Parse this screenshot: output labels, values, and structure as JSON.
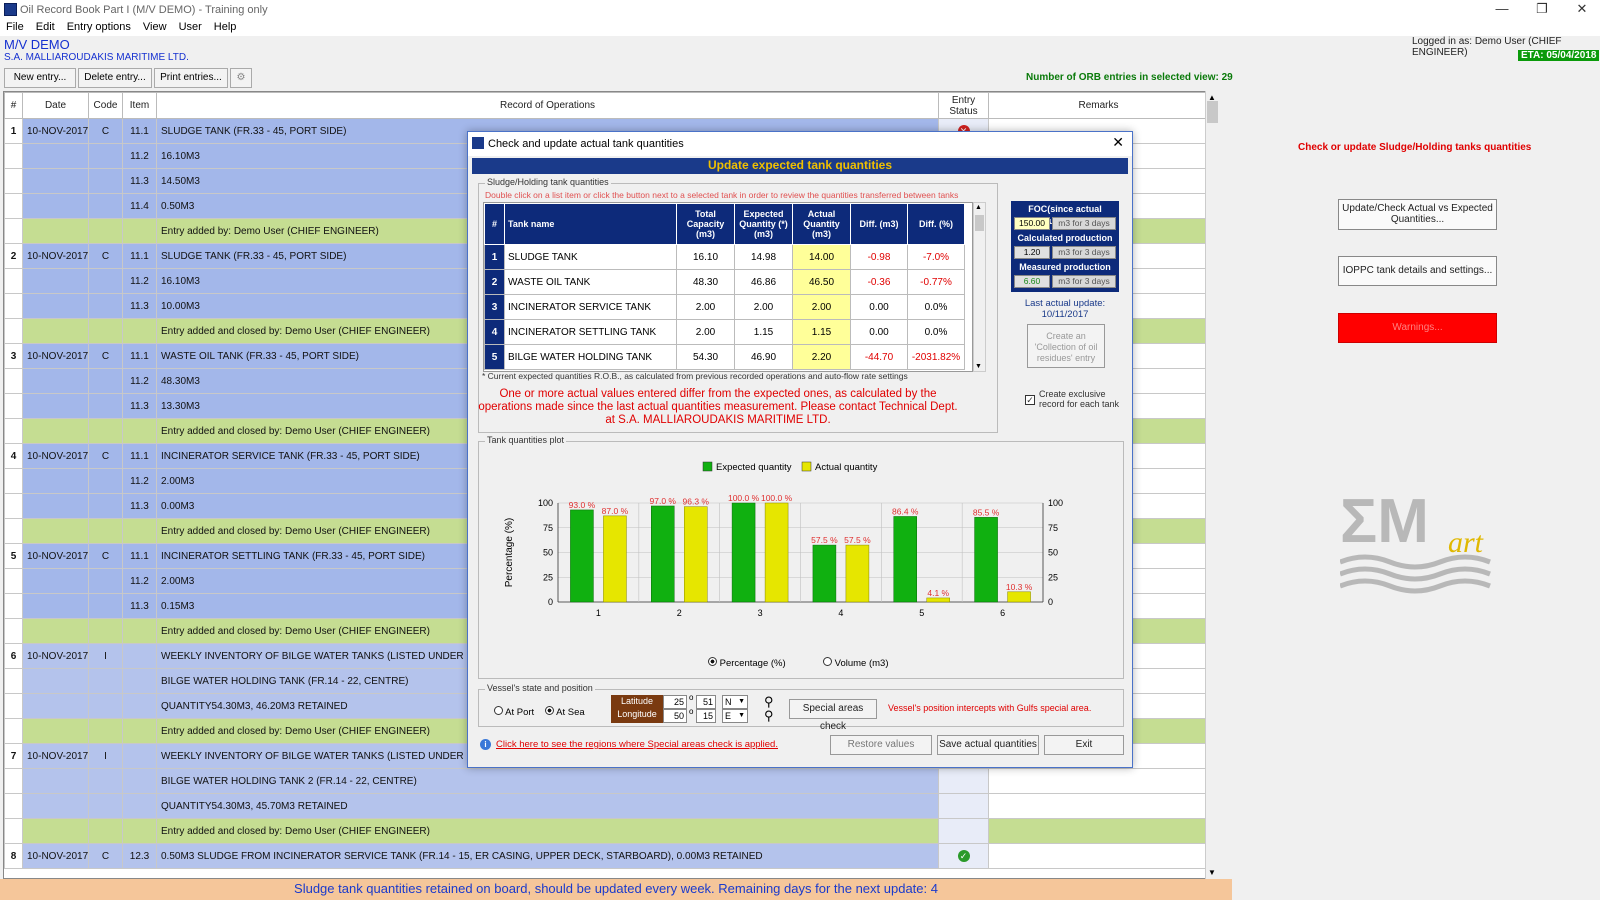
{
  "window": {
    "title": "Oil Record Book Part I (M/V DEMO) - Training only",
    "minimize": "—",
    "restore": "❐",
    "close": "✕"
  },
  "menu": [
    "File",
    "Edit",
    "Entry options",
    "View",
    "User",
    "Help"
  ],
  "header": {
    "vessel": "M/V DEMO",
    "company": "S.A. MALLIAROUDAKIS MARITIME LTD.",
    "logged_in": "Logged in as:  Demo User (CHIEF ENGINEER)",
    "eta": "ETA: 05/04/2018"
  },
  "toolbar": {
    "new": "New entry...",
    "delete": "Delete entry...",
    "print": "Print entries...",
    "count": "Number of ORB entries in selected view: 29"
  },
  "grid": {
    "columns": [
      "#",
      "Date",
      "Code",
      "Item",
      "Record of Operations",
      "Entry Status",
      "Remarks"
    ],
    "rows": [
      {
        "type": "blue",
        "num": "1",
        "date": "10-NOV-2017",
        "code": "C",
        "item": "11.1",
        "rec": "SLUDGE TANK (FR.33 - 45, PORT SIDE)",
        "status": "x"
      },
      {
        "type": "blue",
        "num": "",
        "date": "",
        "code": "",
        "item": "11.2",
        "rec": "16.10M3",
        "status": ""
      },
      {
        "type": "blue",
        "num": "",
        "date": "",
        "code": "",
        "item": "11.3",
        "rec": "14.50M3",
        "status": ""
      },
      {
        "type": "blue",
        "num": "",
        "date": "",
        "code": "",
        "item": "11.4",
        "rec": "0.50M3",
        "status": ""
      },
      {
        "type": "green",
        "num": "",
        "date": "",
        "code": "",
        "item": "",
        "rec": "Entry added by: Demo User (CHIEF ENGINEER)",
        "status": ""
      },
      {
        "type": "blue",
        "num": "2",
        "date": "10-NOV-2017",
        "code": "C",
        "item": "11.1",
        "rec": "SLUDGE TANK (FR.33 - 45, PORT SIDE)",
        "status": ""
      },
      {
        "type": "blue",
        "num": "",
        "date": "",
        "code": "",
        "item": "11.2",
        "rec": "16.10M3",
        "status": ""
      },
      {
        "type": "blue",
        "num": "",
        "date": "",
        "code": "",
        "item": "11.3",
        "rec": "10.00M3",
        "status": ""
      },
      {
        "type": "green",
        "num": "",
        "date": "",
        "code": "",
        "item": "",
        "rec": "Entry added and closed by: Demo User (CHIEF ENGINEER)",
        "status": ""
      },
      {
        "type": "blue",
        "num": "3",
        "date": "10-NOV-2017",
        "code": "C",
        "item": "11.1",
        "rec": "WASTE OIL TANK (FR.33 - 45, PORT SIDE)",
        "status": ""
      },
      {
        "type": "blue",
        "num": "",
        "date": "",
        "code": "",
        "item": "11.2",
        "rec": "48.30M3",
        "status": ""
      },
      {
        "type": "blue",
        "num": "",
        "date": "",
        "code": "",
        "item": "11.3",
        "rec": "13.30M3",
        "status": ""
      },
      {
        "type": "green",
        "num": "",
        "date": "",
        "code": "",
        "item": "",
        "rec": "Entry added and closed by: Demo User (CHIEF ENGINEER)",
        "status": ""
      },
      {
        "type": "blue",
        "num": "4",
        "date": "10-NOV-2017",
        "code": "C",
        "item": "11.1",
        "rec": "INCINERATOR SERVICE TANK (FR.33 - 45, PORT SIDE)",
        "status": ""
      },
      {
        "type": "blue",
        "num": "",
        "date": "",
        "code": "",
        "item": "11.2",
        "rec": "2.00M3",
        "status": ""
      },
      {
        "type": "blue",
        "num": "",
        "date": "",
        "code": "",
        "item": "11.3",
        "rec": "0.00M3",
        "status": ""
      },
      {
        "type": "green",
        "num": "",
        "date": "",
        "code": "",
        "item": "",
        "rec": "Entry added and closed by: Demo User (CHIEF ENGINEER)",
        "status": ""
      },
      {
        "type": "blue",
        "num": "5",
        "date": "10-NOV-2017",
        "code": "C",
        "item": "11.1",
        "rec": "INCINERATOR SETTLING TANK (FR.33 - 45, PORT SIDE)",
        "status": ""
      },
      {
        "type": "blue",
        "num": "",
        "date": "",
        "code": "",
        "item": "11.2",
        "rec": "2.00M3",
        "status": ""
      },
      {
        "type": "blue",
        "num": "",
        "date": "",
        "code": "",
        "item": "11.3",
        "rec": "0.15M3",
        "status": ""
      },
      {
        "type": "green",
        "num": "",
        "date": "",
        "code": "",
        "item": "",
        "rec": "Entry added and closed by: Demo User (CHIEF ENGINEER)",
        "status": ""
      },
      {
        "type": "lblue",
        "num": "6",
        "date": "10-NOV-2017",
        "code": "I",
        "item": "",
        "rec": "WEEKLY INVENTORY OF BILGE WATER TANKS (LISTED UNDER ITEM 3",
        "status": ""
      },
      {
        "type": "lblue",
        "num": "",
        "date": "",
        "code": "",
        "item": "",
        "rec": "BILGE WATER HOLDING TANK (FR.14 - 22, CENTRE)",
        "status": ""
      },
      {
        "type": "lblue",
        "num": "",
        "date": "",
        "code": "",
        "item": "",
        "rec": "QUANTITY54.30M3, 46.20M3 RETAINED",
        "status": ""
      },
      {
        "type": "green",
        "num": "",
        "date": "",
        "code": "",
        "item": "",
        "rec": "Entry added and closed by: Demo User (CHIEF ENGINEER)",
        "status": ""
      },
      {
        "type": "lblue",
        "num": "7",
        "date": "10-NOV-2017",
        "code": "I",
        "item": "",
        "rec": "WEEKLY INVENTORY OF BILGE WATER TANKS (LISTED UNDER ITEM 3",
        "status": ""
      },
      {
        "type": "lblue",
        "num": "",
        "date": "",
        "code": "",
        "item": "",
        "rec": "BILGE WATER HOLDING TANK 2 (FR.14 - 22, CENTRE)",
        "status": ""
      },
      {
        "type": "lblue",
        "num": "",
        "date": "",
        "code": "",
        "item": "",
        "rec": "QUANTITY54.30M3, 45.70M3 RETAINED",
        "status": ""
      },
      {
        "type": "green",
        "num": "",
        "date": "",
        "code": "",
        "item": "",
        "rec": "Entry added and closed by: Demo User (CHIEF ENGINEER)",
        "status": ""
      },
      {
        "type": "lblue",
        "num": "8",
        "date": "10-NOV-2017",
        "code": "C",
        "item": "12.3",
        "rec": "0.50M3 SLUDGE FROM INCINERATOR SERVICE TANK (FR.14 - 15, ER CASING, UPPER DECK, STARBOARD), 0.00M3 RETAINED",
        "status": "ok"
      }
    ]
  },
  "statusbar": "Sludge tank quantities retained on board, should be updated every week. Remaining days for the next update: 4",
  "side": {
    "info": "Check or update Sludge/Holding tanks quantities",
    "update_btn": "Update/Check Actual vs Expected Quantities...",
    "iopp_btn": "IOPPC tank details and settings...",
    "warnings_btn": "Warnings...",
    "logo_big": "ΣM",
    "logo_small": "art"
  },
  "dialog": {
    "title": "Check and update actual tank quantities",
    "close": "✕",
    "heading": "Update expected tank quantities",
    "group_label": "Sludge/Holding tank quantities",
    "hint": "Double click on a list item or click the button next to a selected tank in order to review the quantities transferred between tanks",
    "columns": [
      "#",
      "Tank name",
      "Total Capacity (m3)",
      "Expected Quantity (*) (m3)",
      "Actual Quantity (m3)",
      "Diff. (m3)",
      "Diff. (%)"
    ],
    "tanks": [
      {
        "n": "1",
        "name": "SLUDGE TANK",
        "cap": "16.10",
        "exp": "14.98",
        "act": "14.00",
        "diff": "-0.98",
        "pct": "-7.0%",
        "neg": true
      },
      {
        "n": "2",
        "name": "WASTE OIL TANK",
        "cap": "48.30",
        "exp": "46.86",
        "act": "46.50",
        "diff": "-0.36",
        "pct": "-0.77%",
        "neg": true
      },
      {
        "n": "3",
        "name": "INCINERATOR SERVICE TANK",
        "cap": "2.00",
        "exp": "2.00",
        "act": "2.00",
        "diff": "0.00",
        "pct": "0.0%",
        "neg": false
      },
      {
        "n": "4",
        "name": "INCINERATOR SETTLING TANK",
        "cap": "2.00",
        "exp": "1.15",
        "act": "1.15",
        "diff": "0.00",
        "pct": "0.0%",
        "neg": false
      },
      {
        "n": "5",
        "name": "BILGE WATER HOLDING TANK",
        "cap": "54.30",
        "exp": "46.90",
        "act": "2.20",
        "diff": "-44.70",
        "pct": "-2031.82%",
        "neg": true
      }
    ],
    "footnote": "* Current expected quantities R.O.B., as calculated from previous recorded operations and auto-flow rate settings",
    "warning": "One or more actual values entered differ from the expected ones, as calculated by the operations made since the last actual quantities measurement. Please contact Technical Dept. at S.A. MALLIAROUDAKIS MARITIME LTD.",
    "foc": {
      "h1": "FOC(since actual update)",
      "v1": "150.00",
      "u1": "m3 for 3 days",
      "h2": "Calculated production",
      "v2": "1.20",
      "u2": "m3 for 3 days",
      "h3": "Measured production",
      "v3": "6.60",
      "u3": "m3 for 3 days"
    },
    "last_update_label": "Last actual update:",
    "last_update": "10/11/2017",
    "collection_btn": "Create an 'Collection of oil residues' entry",
    "exclusive": "Create exclusive record for each tank",
    "plot_label": "Tank quantities plot",
    "radio_pct": "Percentage (%)",
    "radio_vol": "Volume (m3)",
    "vessel_label": "Vessel's state and position",
    "at_port": "At Port",
    "at_sea": "At Sea",
    "lat_label": "Latitude",
    "lon_label": "Longitude",
    "lat_deg": "25",
    "lat_min": "51",
    "lat_hem": "N",
    "lon_deg": "50",
    "lon_min": "15",
    "lon_hem": "E",
    "special_btn": "Special areas check",
    "position_msg": "Vessel's position intercepts with Gulfs special area.",
    "link": "Click here to see the regions where Special areas check is applied.",
    "restore_btn": "Restore values",
    "save_btn": "Save actual quantities",
    "exit_btn": "Exit"
  },
  "chart_data": {
    "type": "bar",
    "categories": [
      "1",
      "2",
      "3",
      "4",
      "5",
      "6"
    ],
    "series": [
      {
        "name": "Expected quantity",
        "color": "#10b010",
        "values": [
          93.0,
          97.0,
          100.0,
          57.5,
          86.4,
          85.5
        ]
      },
      {
        "name": "Actual quantity",
        "color": "#e6e600",
        "values": [
          87.0,
          96.3,
          100.0,
          57.5,
          4.1,
          10.3
        ]
      }
    ],
    "labels_expected": [
      "93.0 %",
      "97.0 %",
      "100.0 %",
      "57.5 %",
      "86.4 %",
      "85.5 %"
    ],
    "labels_actual": [
      "87.0 %",
      "96.3 %",
      "100.0 %",
      "57.5 %",
      "4.1 %",
      "10.3 %"
    ],
    "ylabel": "Percentage (%)",
    "ylim": [
      0,
      100
    ],
    "yticks": [
      "0",
      "25",
      "50",
      "75",
      "100"
    ],
    "legend": "top-center",
    "grid": true
  }
}
